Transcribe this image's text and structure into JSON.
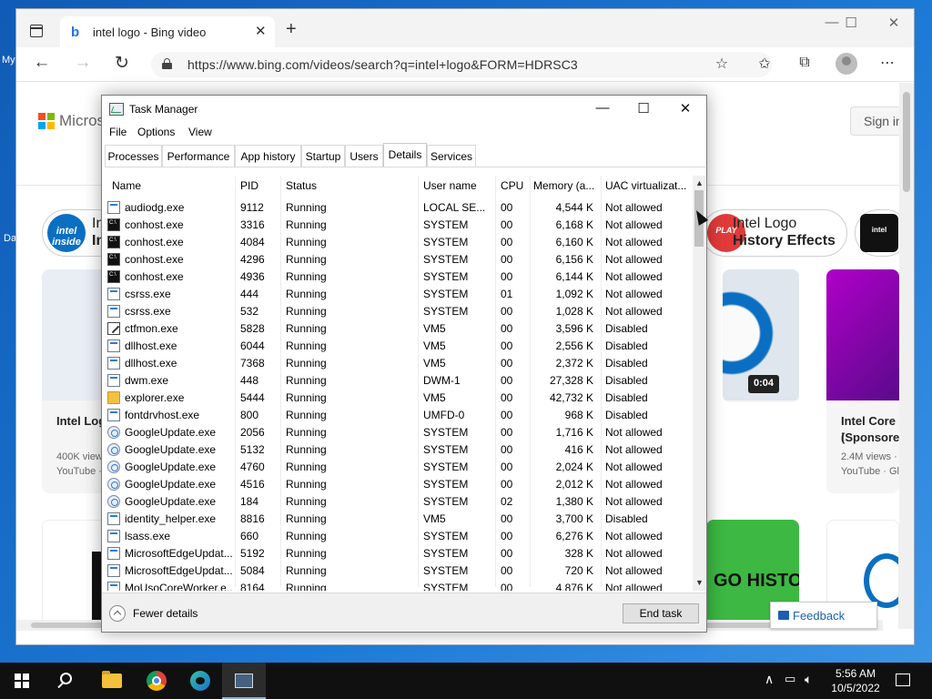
{
  "desktop": {
    "label1": "My",
    "label2": "Da"
  },
  "browser": {
    "tab_title": "intel logo - Bing video",
    "tab_close": "✕",
    "new_tab": "+",
    "url": "https://www.bing.com/videos/search?q=intel+logo&FORM=HDRSC3",
    "window_controls": {
      "minimize": "—",
      "maximize": "☐",
      "close": "✕"
    }
  },
  "bing": {
    "brand_text": "Microso",
    "sign_in": "Sign in",
    "pill_left": {
      "badge": "intel inside",
      "line1": "In",
      "line2": "In"
    },
    "pill_right": {
      "line1": "Intel Logo",
      "line2": "History Effects"
    },
    "cards": [
      {
        "title": "Intel Log",
        "views": "400K view",
        "source": "YouTube ·"
      },
      {
        "duration": "0:04"
      },
      {
        "title": "Intel Core i",
        "subtitle": "(Sponsored",
        "views": "2.4M views ·",
        "source": "YouTube · Gl"
      }
    ],
    "bottom_banner": "GO HISTORY",
    "feedback": "Feedback",
    "colors": {
      "accent": "#1a5fb4",
      "intel_blue": "#0a6fc2",
      "banner_green": "#3db843"
    }
  },
  "taskmanager": {
    "title": "Task Manager",
    "controls": {
      "minimize": "—",
      "maximize": "☐",
      "close": "✕"
    },
    "menu": [
      "File",
      "Options",
      "View"
    ],
    "tabs": [
      "Processes",
      "Performance",
      "App history",
      "Startup",
      "Users",
      "Details",
      "Services"
    ],
    "active_tab": "Details",
    "columns": [
      "Name",
      "PID",
      "Status",
      "User name",
      "CPU",
      "Memory (a...",
      "UAC virtualizat..."
    ],
    "rows": [
      {
        "icon": "app",
        "name": "audiodg.exe",
        "pid": "9112",
        "status": "Running",
        "user": "LOCAL SE...",
        "cpu": "00",
        "mem": "4,544 K",
        "uac": "Not allowed"
      },
      {
        "icon": "con",
        "name": "conhost.exe",
        "pid": "3316",
        "status": "Running",
        "user": "SYSTEM",
        "cpu": "00",
        "mem": "6,168 K",
        "uac": "Not allowed"
      },
      {
        "icon": "con",
        "name": "conhost.exe",
        "pid": "4084",
        "status": "Running",
        "user": "SYSTEM",
        "cpu": "00",
        "mem": "6,160 K",
        "uac": "Not allowed"
      },
      {
        "icon": "con",
        "name": "conhost.exe",
        "pid": "4296",
        "status": "Running",
        "user": "SYSTEM",
        "cpu": "00",
        "mem": "6,156 K",
        "uac": "Not allowed"
      },
      {
        "icon": "con",
        "name": "conhost.exe",
        "pid": "4936",
        "status": "Running",
        "user": "SYSTEM",
        "cpu": "00",
        "mem": "6,144 K",
        "uac": "Not allowed"
      },
      {
        "icon": "app",
        "name": "csrss.exe",
        "pid": "444",
        "status": "Running",
        "user": "SYSTEM",
        "cpu": "01",
        "mem": "1,092 K",
        "uac": "Not allowed"
      },
      {
        "icon": "app",
        "name": "csrss.exe",
        "pid": "532",
        "status": "Running",
        "user": "SYSTEM",
        "cpu": "00",
        "mem": "1,028 K",
        "uac": "Not allowed"
      },
      {
        "icon": "ctf",
        "name": "ctfmon.exe",
        "pid": "5828",
        "status": "Running",
        "user": "VM5",
        "cpu": "00",
        "mem": "3,596 K",
        "uac": "Disabled"
      },
      {
        "icon": "app",
        "name": "dllhost.exe",
        "pid": "6044",
        "status": "Running",
        "user": "VM5",
        "cpu": "00",
        "mem": "2,556 K",
        "uac": "Disabled"
      },
      {
        "icon": "app",
        "name": "dllhost.exe",
        "pid": "7368",
        "status": "Running",
        "user": "VM5",
        "cpu": "00",
        "mem": "2,372 K",
        "uac": "Disabled"
      },
      {
        "icon": "app",
        "name": "dwm.exe",
        "pid": "448",
        "status": "Running",
        "user": "DWM-1",
        "cpu": "00",
        "mem": "27,328 K",
        "uac": "Disabled"
      },
      {
        "icon": "exp",
        "name": "explorer.exe",
        "pid": "5444",
        "status": "Running",
        "user": "VM5",
        "cpu": "00",
        "mem": "42,732 K",
        "uac": "Disabled"
      },
      {
        "icon": "app",
        "name": "fontdrvhost.exe",
        "pid": "800",
        "status": "Running",
        "user": "UMFD-0",
        "cpu": "00",
        "mem": "968 K",
        "uac": "Disabled"
      },
      {
        "icon": "gu",
        "name": "GoogleUpdate.exe",
        "pid": "2056",
        "status": "Running",
        "user": "SYSTEM",
        "cpu": "00",
        "mem": "1,716 K",
        "uac": "Not allowed"
      },
      {
        "icon": "gu",
        "name": "GoogleUpdate.exe",
        "pid": "5132",
        "status": "Running",
        "user": "SYSTEM",
        "cpu": "00",
        "mem": "416 K",
        "uac": "Not allowed"
      },
      {
        "icon": "gu",
        "name": "GoogleUpdate.exe",
        "pid": "4760",
        "status": "Running",
        "user": "SYSTEM",
        "cpu": "00",
        "mem": "2,024 K",
        "uac": "Not allowed"
      },
      {
        "icon": "gu",
        "name": "GoogleUpdate.exe",
        "pid": "4516",
        "status": "Running",
        "user": "SYSTEM",
        "cpu": "00",
        "mem": "2,012 K",
        "uac": "Not allowed"
      },
      {
        "icon": "gu",
        "name": "GoogleUpdate.exe",
        "pid": "184",
        "status": "Running",
        "user": "SYSTEM",
        "cpu": "02",
        "mem": "1,380 K",
        "uac": "Not allowed"
      },
      {
        "icon": "app",
        "name": "identity_helper.exe",
        "pid": "8816",
        "status": "Running",
        "user": "VM5",
        "cpu": "00",
        "mem": "3,700 K",
        "uac": "Disabled"
      },
      {
        "icon": "app",
        "name": "lsass.exe",
        "pid": "660",
        "status": "Running",
        "user": "SYSTEM",
        "cpu": "00",
        "mem": "6,276 K",
        "uac": "Not allowed"
      },
      {
        "icon": "app",
        "name": "MicrosoftEdgeUpdat...",
        "pid": "5192",
        "status": "Running",
        "user": "SYSTEM",
        "cpu": "00",
        "mem": "328 K",
        "uac": "Not allowed"
      },
      {
        "icon": "app",
        "name": "MicrosoftEdgeUpdat...",
        "pid": "5084",
        "status": "Running",
        "user": "SYSTEM",
        "cpu": "00",
        "mem": "720 K",
        "uac": "Not allowed"
      },
      {
        "icon": "app",
        "name": "MoUsoCoreWorker.e...",
        "pid": "8164",
        "status": "Running",
        "user": "SYSTEM",
        "cpu": "00",
        "mem": "4,876 K",
        "uac": "Not allowed"
      }
    ],
    "footer": {
      "fewer_details": "Fewer details",
      "end_task": "End task"
    }
  },
  "taskbar": {
    "clock_time": "5:56 AM",
    "clock_date": "10/5/2022"
  }
}
